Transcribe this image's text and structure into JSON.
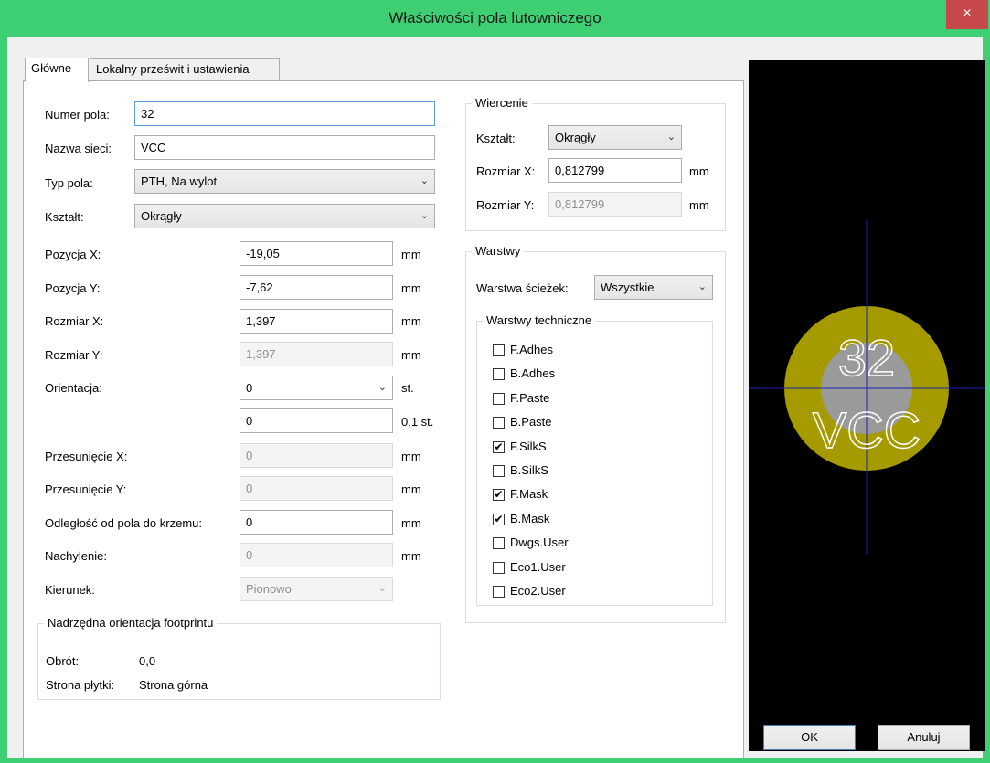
{
  "window": {
    "title": "Właściwości pola lutowniczego",
    "close_glyph": "×"
  },
  "tabs": [
    {
      "label": "Główne"
    },
    {
      "label": "Lokalny prześwit i ustawienia"
    }
  ],
  "general": {
    "pad_number": {
      "label": "Numer pola:",
      "value": "32"
    },
    "net_name": {
      "label": "Nazwa sieci:",
      "value": "VCC"
    },
    "pad_type": {
      "label": "Typ pola:",
      "value": "PTH, Na wylot"
    },
    "shape": {
      "label": "Kształt:",
      "value": "Okrągły"
    },
    "pos_x": {
      "label": "Pozycja X:",
      "value": "-19,05",
      "unit": "mm"
    },
    "pos_y": {
      "label": "Pozycja Y:",
      "value": "-7,62",
      "unit": "mm"
    },
    "size_x": {
      "label": "Rozmiar X:",
      "value": "1,397",
      "unit": "mm"
    },
    "size_y": {
      "label": "Rozmiar Y:",
      "value": "1,397",
      "unit": "mm"
    },
    "orientation": {
      "label": "Orientacja:",
      "value": "0",
      "unit": "st.",
      "custom_value": "0",
      "custom_unit": "0,1 st."
    },
    "offset_x": {
      "label": "Przesunięcie X:",
      "value": "0",
      "unit": "mm"
    },
    "offset_y": {
      "label": "Przesunięcie Y:",
      "value": "0",
      "unit": "mm"
    },
    "die_length": {
      "label": "Odległość od pola do krzemu:",
      "value": "0",
      "unit": "mm"
    },
    "trapezoid": {
      "label": "Nachylenie:",
      "value": "0",
      "unit": "mm"
    },
    "direction": {
      "label": "Kierunek:",
      "value": "Pionowo"
    }
  },
  "footprint_orientation": {
    "legend": "Nadrzędna orientacja footprintu",
    "rotation_label": "Obrót:",
    "rotation_value": "0,0",
    "side_label": "Strona płytki:",
    "side_value": "Strona górna"
  },
  "drill": {
    "legend": "Wiercenie",
    "shape": {
      "label": "Kształt:",
      "value": "Okrągły"
    },
    "size_x": {
      "label": "Rozmiar X:",
      "value": "0,812799",
      "unit": "mm"
    },
    "size_y": {
      "label": "Rozmiar Y:",
      "value": "0,812799",
      "unit": "mm"
    }
  },
  "layers": {
    "legend": "Warstwy",
    "copper_label": "Warstwa ścieżek:",
    "copper_value": "Wszystkie",
    "technical_legend": "Warstwy techniczne",
    "items": [
      {
        "label": "F.Adhes",
        "checked": false
      },
      {
        "label": "B.Adhes",
        "checked": false
      },
      {
        "label": "F.Paste",
        "checked": false
      },
      {
        "label": "B.Paste",
        "checked": false
      },
      {
        "label": "F.SilkS",
        "checked": true
      },
      {
        "label": "B.SilkS",
        "checked": false
      },
      {
        "label": "F.Mask",
        "checked": true
      },
      {
        "label": "B.Mask",
        "checked": true
      },
      {
        "label": "Dwgs.User",
        "checked": false
      },
      {
        "label": "Eco1.User",
        "checked": false
      },
      {
        "label": "Eco2.User",
        "checked": false
      }
    ]
  },
  "preview": {
    "pad_number": "32",
    "net_name": "VCC",
    "pad_color": "#a59a00",
    "hole_color": "#9a9a9a",
    "crosshair_color": "#1c22b0"
  },
  "buttons": {
    "ok": "OK",
    "cancel": "Anuluj"
  }
}
